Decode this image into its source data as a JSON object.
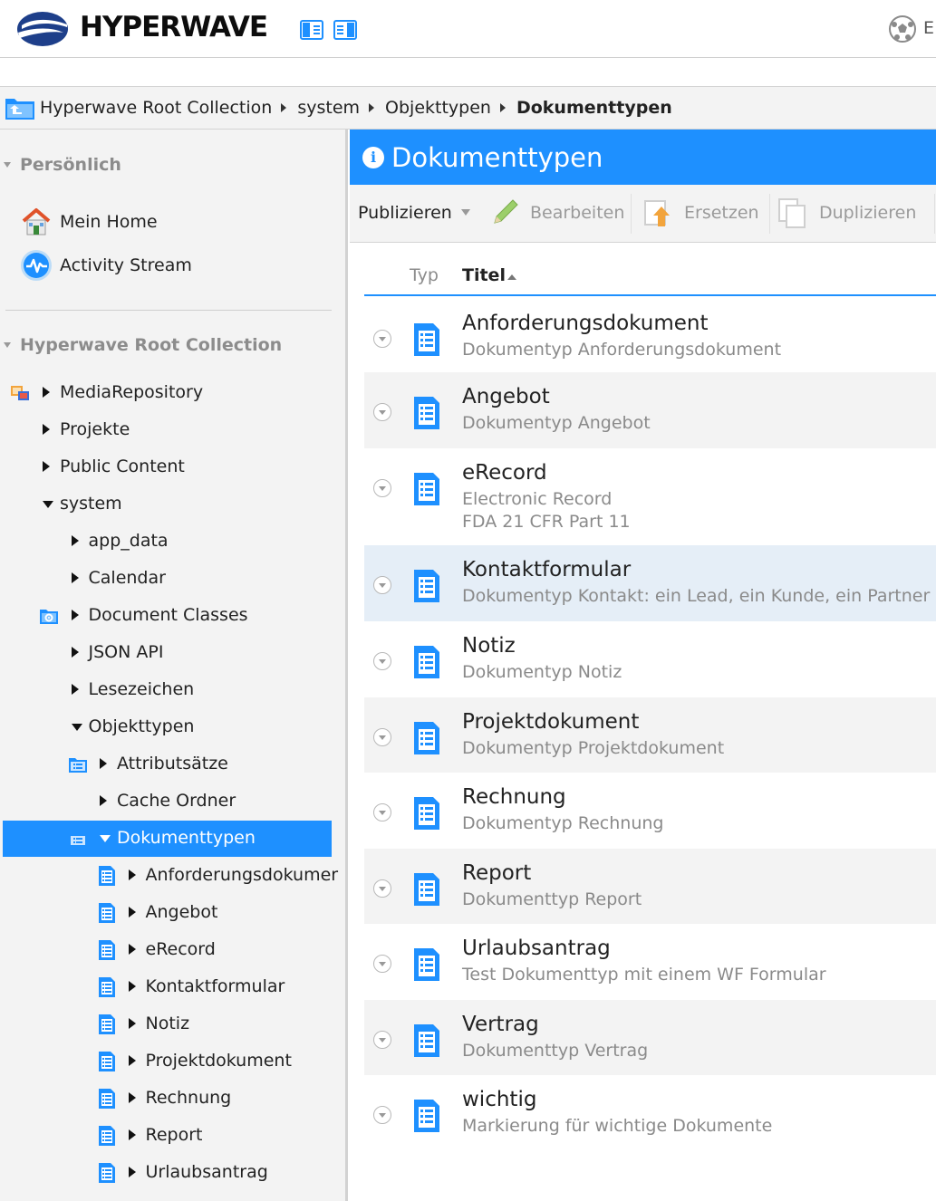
{
  "header": {
    "brand": "HYPERWAVE",
    "language_label": "E",
    "view_buttons": [
      "layout-left-icon",
      "layout-right-icon"
    ]
  },
  "breadcrumb": {
    "items": [
      "Hyperwave Root Collection",
      "system",
      "Objekttypen",
      "Dokumenttypen"
    ]
  },
  "sidebar": {
    "personal_title": "Persönlich",
    "favorites": [
      {
        "label": "Mein Home",
        "icon": "home-icon"
      },
      {
        "label": "Activity Stream",
        "icon": "activity-stream-icon"
      }
    ],
    "root_title": "Hyperwave Root Collection",
    "tree": [
      {
        "label": "MediaRepository",
        "level": 0,
        "expanded": false,
        "icon": "media-repository-icon"
      },
      {
        "label": "Projekte",
        "level": 0,
        "expanded": false,
        "icon": ""
      },
      {
        "label": "Public Content",
        "level": 0,
        "expanded": false,
        "icon": ""
      },
      {
        "label": "system",
        "level": 0,
        "expanded": true,
        "icon": ""
      },
      {
        "label": "app_data",
        "level": 1,
        "expanded": false,
        "icon": ""
      },
      {
        "label": "Calendar",
        "level": 1,
        "expanded": false,
        "icon": ""
      },
      {
        "label": "Document Classes",
        "level": 1,
        "expanded": false,
        "icon": "settings-folder-icon"
      },
      {
        "label": "JSON API",
        "level": 1,
        "expanded": false,
        "icon": ""
      },
      {
        "label": "Lesezeichen",
        "level": 1,
        "expanded": false,
        "icon": ""
      },
      {
        "label": "Objekttypen",
        "level": 1,
        "expanded": true,
        "icon": ""
      },
      {
        "label": "Attributsätze",
        "level": 2,
        "expanded": false,
        "icon": "list-folder-icon"
      },
      {
        "label": "Cache Ordner",
        "level": 2,
        "expanded": false,
        "icon": ""
      },
      {
        "label": "Dokumenttypen",
        "level": 2,
        "expanded": true,
        "icon": "list-folder-icon",
        "selected": true
      },
      {
        "label": "Anforderungsdokumer",
        "level": 3,
        "expanded": false,
        "icon": "document-type-icon"
      },
      {
        "label": "Angebot",
        "level": 3,
        "expanded": false,
        "icon": "document-type-icon"
      },
      {
        "label": "eRecord",
        "level": 3,
        "expanded": false,
        "icon": "document-type-icon"
      },
      {
        "label": "Kontaktformular",
        "level": 3,
        "expanded": false,
        "icon": "document-type-icon"
      },
      {
        "label": "Notiz",
        "level": 3,
        "expanded": false,
        "icon": "document-type-icon"
      },
      {
        "label": "Projektdokument",
        "level": 3,
        "expanded": false,
        "icon": "document-type-icon"
      },
      {
        "label": "Rechnung",
        "level": 3,
        "expanded": false,
        "icon": "document-type-icon"
      },
      {
        "label": "Report",
        "level": 3,
        "expanded": false,
        "icon": "document-type-icon"
      },
      {
        "label": "Urlaubsantrag",
        "level": 3,
        "expanded": false,
        "icon": "document-type-icon"
      }
    ]
  },
  "main": {
    "title": "Dokumenttypen",
    "toolbar": {
      "publish": "Publizieren",
      "edit": "Bearbeiten",
      "replace": "Ersetzen",
      "duplicate": "Duplizieren"
    },
    "columns": {
      "type": "Typ",
      "title": "Titel"
    },
    "rows": [
      {
        "title": "Anforderungsdokument",
        "desc": [
          "Dokumentyp Anforderungsdokument"
        ]
      },
      {
        "title": "Angebot",
        "desc": [
          "Dokumentyp Angebot"
        ]
      },
      {
        "title": "eRecord",
        "desc": [
          "Electronic Record",
          "FDA 21 CFR Part 11"
        ]
      },
      {
        "title": "Kontaktformular",
        "desc": [
          "Dokumentyp Kontakt: ein Lead, ein Kunde, ein Partner"
        ]
      },
      {
        "title": "Notiz",
        "desc": [
          "Dokumentyp Notiz"
        ]
      },
      {
        "title": "Projektdokument",
        "desc": [
          "Dokumentyp Projektdokument"
        ]
      },
      {
        "title": "Rechnung",
        "desc": [
          "Dokumentyp Rechnung"
        ]
      },
      {
        "title": "Report",
        "desc": [
          "Dokumenttyp Report"
        ]
      },
      {
        "title": "Urlaubsantrag",
        "desc": [
          "Test Dokumenttyp mit einem WF Formular"
        ]
      },
      {
        "title": "Vertrag",
        "desc": [
          "Dokumenttyp Vertrag"
        ]
      },
      {
        "title": "wichtig",
        "desc": [
          "Markierung für wichtige Dokumente"
        ]
      }
    ]
  },
  "colors": {
    "accent": "#1e90ff",
    "panel_bg": "#f3f3f3",
    "selected_row": "#e5eef7",
    "muted_text": "#8a8a8a"
  }
}
